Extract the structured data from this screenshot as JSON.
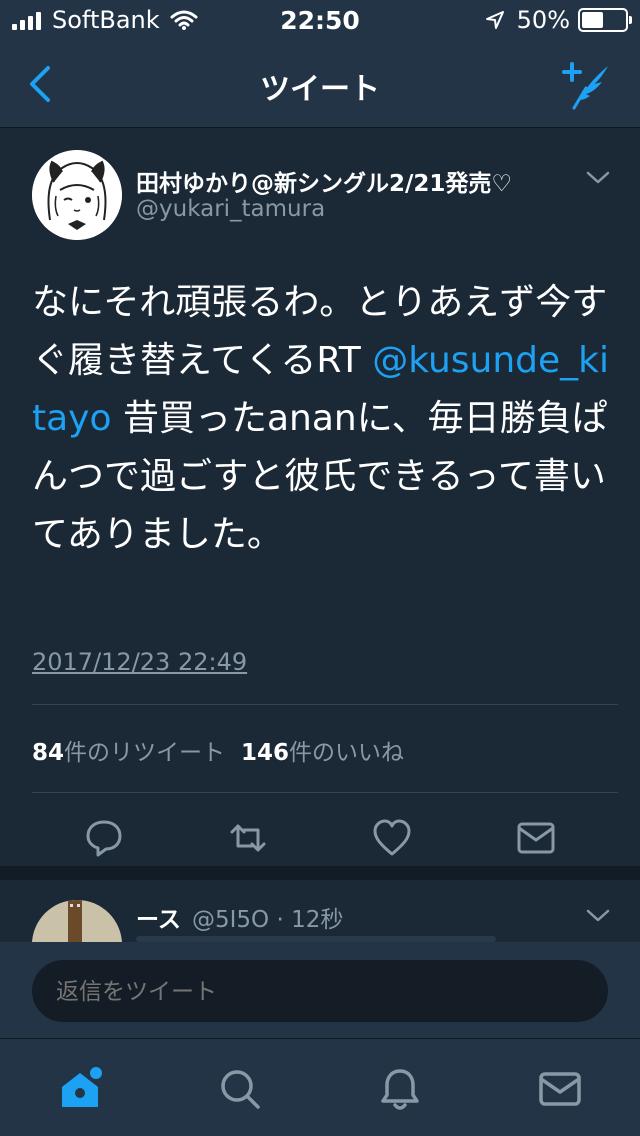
{
  "status_bar": {
    "carrier": "SoftBank",
    "time": "22:50",
    "battery_text": "50%",
    "battery_level": 0.5
  },
  "nav": {
    "title": "ツイート",
    "back_icon": "chevron-left-icon",
    "compose_icon": "compose-tweet-icon"
  },
  "tweet": {
    "author_name": "田村ゆかり@新シングル2/21発売♡",
    "author_handle": "@yukari_tamura",
    "text_before": "なにそれ頑張るわ。とりあえず今すぐ履き替えてくるRT ",
    "mention": "@kusunde_kitayo",
    "text_after": " 昔買ったananに、毎日勝負ぱんつで過ごすと彼氏できるって書いてありました。",
    "timestamp": "2017/12/23 22:49",
    "retweet_count": "84",
    "retweet_label": "件のリツイート",
    "like_count": "146",
    "like_label": "件のいいね",
    "actions": [
      "reply-icon",
      "retweet-icon",
      "like-icon",
      "direct-message-icon"
    ]
  },
  "reply_tweet": {
    "author_name": "ース",
    "meta": "@5I5O · 12秒"
  },
  "reply_bar": {
    "placeholder": "返信をツイート"
  },
  "tab_bar": {
    "tabs": [
      "home-icon",
      "search-icon",
      "notifications-icon",
      "messages-icon"
    ],
    "active": "home-icon"
  },
  "colors": {
    "background": "#1b2836",
    "bar": "#243447",
    "accent": "#1da1f2",
    "secondary_text": "#8899a6"
  }
}
